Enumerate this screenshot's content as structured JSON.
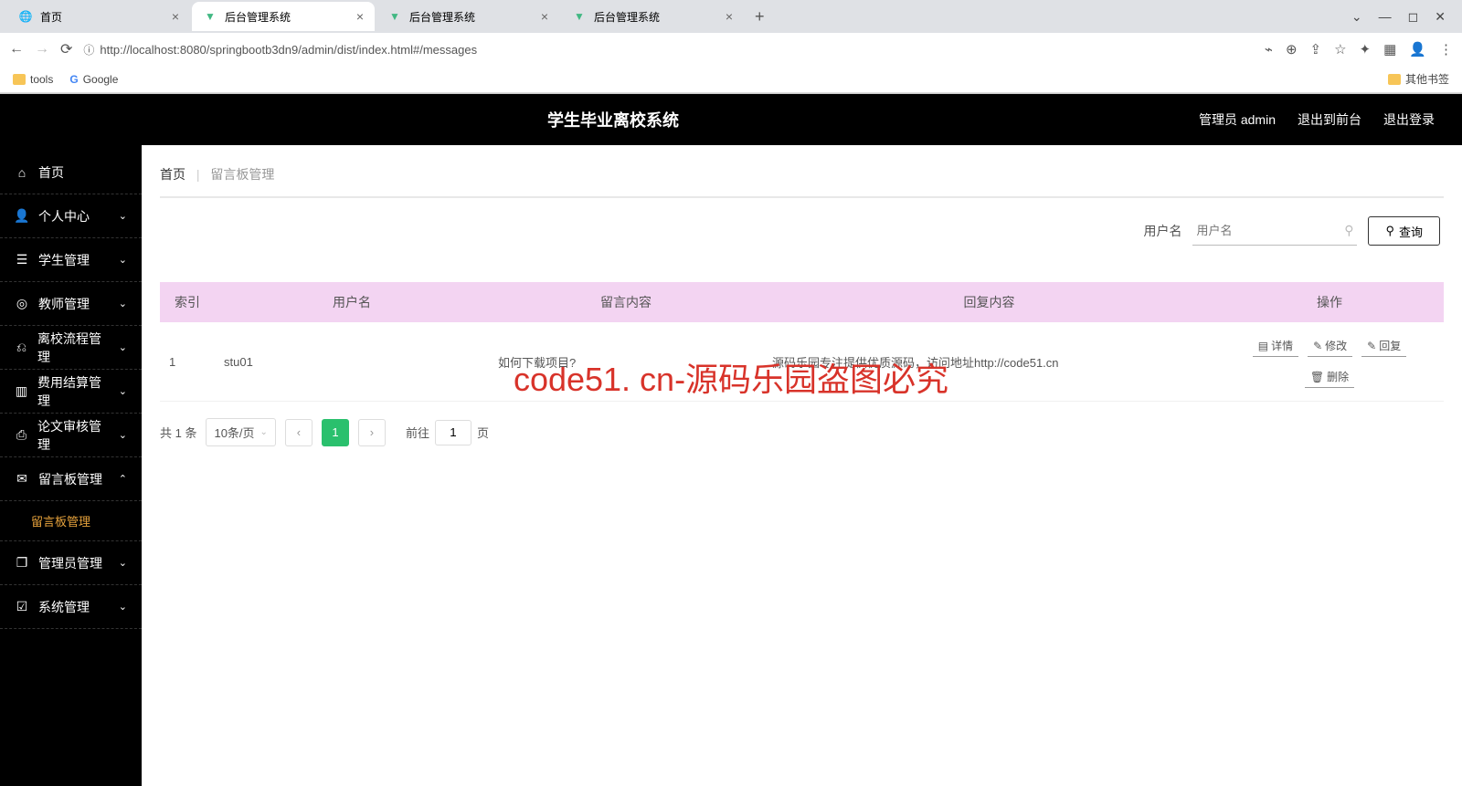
{
  "browser": {
    "tabs": [
      {
        "title": "首页",
        "active": false
      },
      {
        "title": "后台管理系统",
        "active": true
      },
      {
        "title": "后台管理系统",
        "active": false
      },
      {
        "title": "后台管理系统",
        "active": false
      }
    ],
    "url": "http://localhost:8080/springbootb3dn9/admin/dist/index.html#/messages",
    "bookmarks": {
      "tools": "tools",
      "google": "Google",
      "other": "其他书签"
    }
  },
  "header": {
    "title": "学生毕业离校系统",
    "user": "管理员 admin",
    "to_front": "退出到前台",
    "logout": "退出登录"
  },
  "sidebar": {
    "items": [
      {
        "label": "首页",
        "icon": "home",
        "expandable": false
      },
      {
        "label": "个人中心",
        "icon": "user",
        "expandable": true
      },
      {
        "label": "学生管理",
        "icon": "list",
        "expandable": true
      },
      {
        "label": "教师管理",
        "icon": "gear",
        "expandable": true
      },
      {
        "label": "离校流程管理",
        "icon": "flow",
        "expandable": true
      },
      {
        "label": "费用结算管理",
        "icon": "chart",
        "expandable": true
      },
      {
        "label": "论文审核管理",
        "icon": "doc",
        "expandable": true
      },
      {
        "label": "留言板管理",
        "icon": "msg",
        "expandable": true,
        "open": true,
        "children": [
          {
            "label": "留言板管理"
          }
        ]
      },
      {
        "label": "管理员管理",
        "icon": "copy",
        "expandable": true
      },
      {
        "label": "系统管理",
        "icon": "sys",
        "expandable": true
      }
    ]
  },
  "breadcrumb": {
    "home": "首页",
    "current": "留言板管理"
  },
  "search": {
    "label": "用户名",
    "placeholder": "用户名",
    "button": "查询"
  },
  "table": {
    "columns": [
      "索引",
      "用户名",
      "留言内容",
      "回复内容",
      "操作"
    ],
    "rows": [
      {
        "index": "1",
        "username": "stu01",
        "content": "如何下载项目?",
        "reply": "源码乐园专注提供优质源码，访问地址http://code51.cn"
      }
    ],
    "actions": {
      "detail": "详情",
      "edit": "修改",
      "reply": "回复",
      "delete": "删除"
    }
  },
  "pagination": {
    "total": "共 1 条",
    "page_size": "10条/页",
    "current": "1",
    "goto_prefix": "前往",
    "goto_value": "1",
    "goto_suffix": "页"
  },
  "watermark": "code51. cn-源码乐园盗图必究"
}
